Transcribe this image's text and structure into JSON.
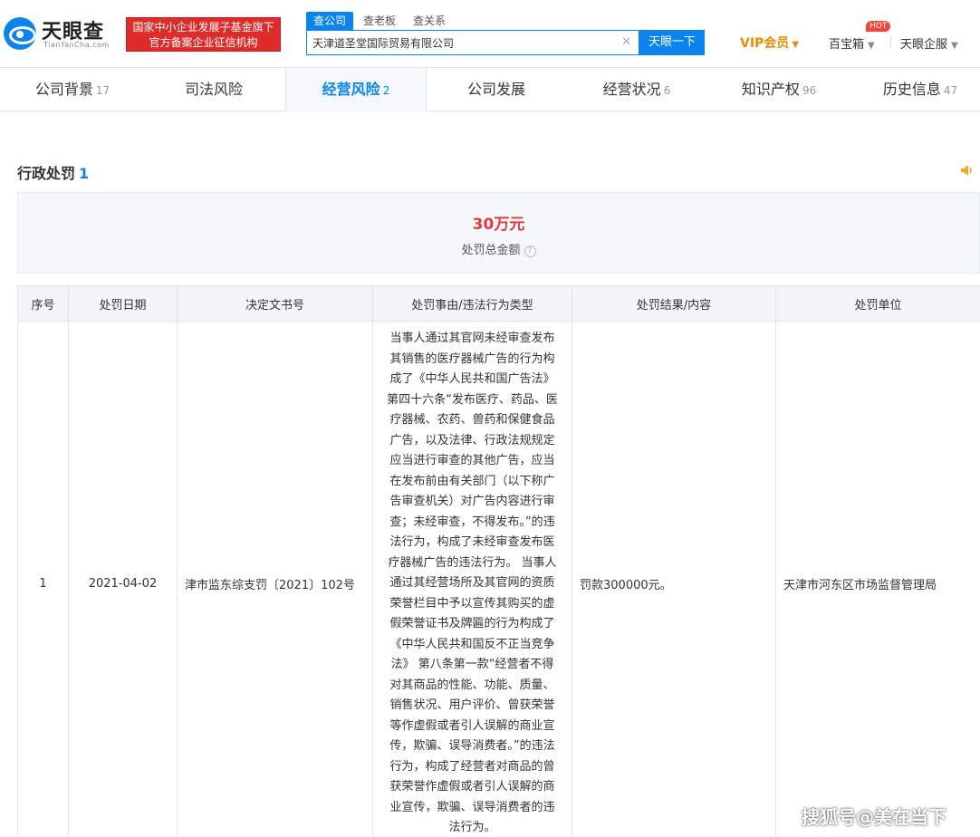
{
  "header": {
    "logo_text": "天眼查",
    "logo_sub": "TianYanCha.com",
    "gov_badge_line1": "国家中小企业发展子基金旗下",
    "gov_badge_line2": "官方备案企业征信机构",
    "search_tabs": [
      "查公司",
      "查老板",
      "查关系"
    ],
    "search_value": "天津道圣堂国际贸易有限公司",
    "search_button": "天眼一下",
    "vip_label": "VIP会员",
    "baobox_label": "百宝箱",
    "hot_badge": "HOT",
    "qifu_label": "天眼企服"
  },
  "nav": {
    "tabs": [
      {
        "label": "公司背景",
        "count": "17"
      },
      {
        "label": "司法风险",
        "count": ""
      },
      {
        "label": "经营风险",
        "count": "2"
      },
      {
        "label": "公司发展",
        "count": ""
      },
      {
        "label": "经营状况",
        "count": "6"
      },
      {
        "label": "知识产权",
        "count": "96"
      },
      {
        "label": "历史信息",
        "count": "47"
      }
    ],
    "active_index": 2
  },
  "section": {
    "title": "行政处罚",
    "count": "1",
    "summary_amount": "30万元",
    "summary_label": "处罚总金额"
  },
  "table": {
    "headers": [
      "序号",
      "处罚日期",
      "决定文书号",
      "处罚事由/违法行为类型",
      "处罚结果/内容",
      "处罚单位"
    ],
    "rows": [
      {
        "index": "1",
        "date": "2021-04-02",
        "doc_no": "津市监东综支罚〔2021〕102号",
        "reason_lines": [
          "当事人通过其官网未经审查发布",
          "其销售的医疗器械广告的行为构",
          "成了《中华人民共和国广告法》",
          "第四十六条“发布医疗、药品、医",
          "疗器械、农药、兽药和保健食品",
          "广告，以及法律、行政法规规定",
          "应当进行审查的其他广告，应当",
          "在发布前由有关部门（以下称广",
          "告审查机关）对广告内容进行审",
          "查；未经审查，不得发布。”的违",
          "法行为，构成了未经审查发布医",
          "疗器械广告的违法行为。 当事人",
          "通过其经营场所及其官网的资质",
          "荣誉栏目中予以宣传其购买的虚",
          "假荣誉证书及牌匾的行为构成了",
          "《中华人民共和国反不正当竞争",
          "法》 第八条第一款“经营者不得",
          "对其商品的性能、功能、质量、",
          "销售状况、用户评价、曾获荣誉",
          "等作虚假或者引人误解的商业宣",
          "传，欺骗、误导消费者。”的违法",
          "行为，构成了经营者对商品的曾",
          "获荣誉作虚假或者引人误解的商",
          "业宣传，欺骗、误导消费者的违",
          "法行为。"
        ],
        "result": "罚款300000元。",
        "unit": "天津市河东区市场监督管理局"
      }
    ]
  },
  "watermark": "搜狐号@美在当下",
  "colors": {
    "brand_blue": "#0b84ee",
    "badge_red": "#e02b2b",
    "amount_red": "#e23a3a",
    "vip_orange": "#f08a00"
  }
}
